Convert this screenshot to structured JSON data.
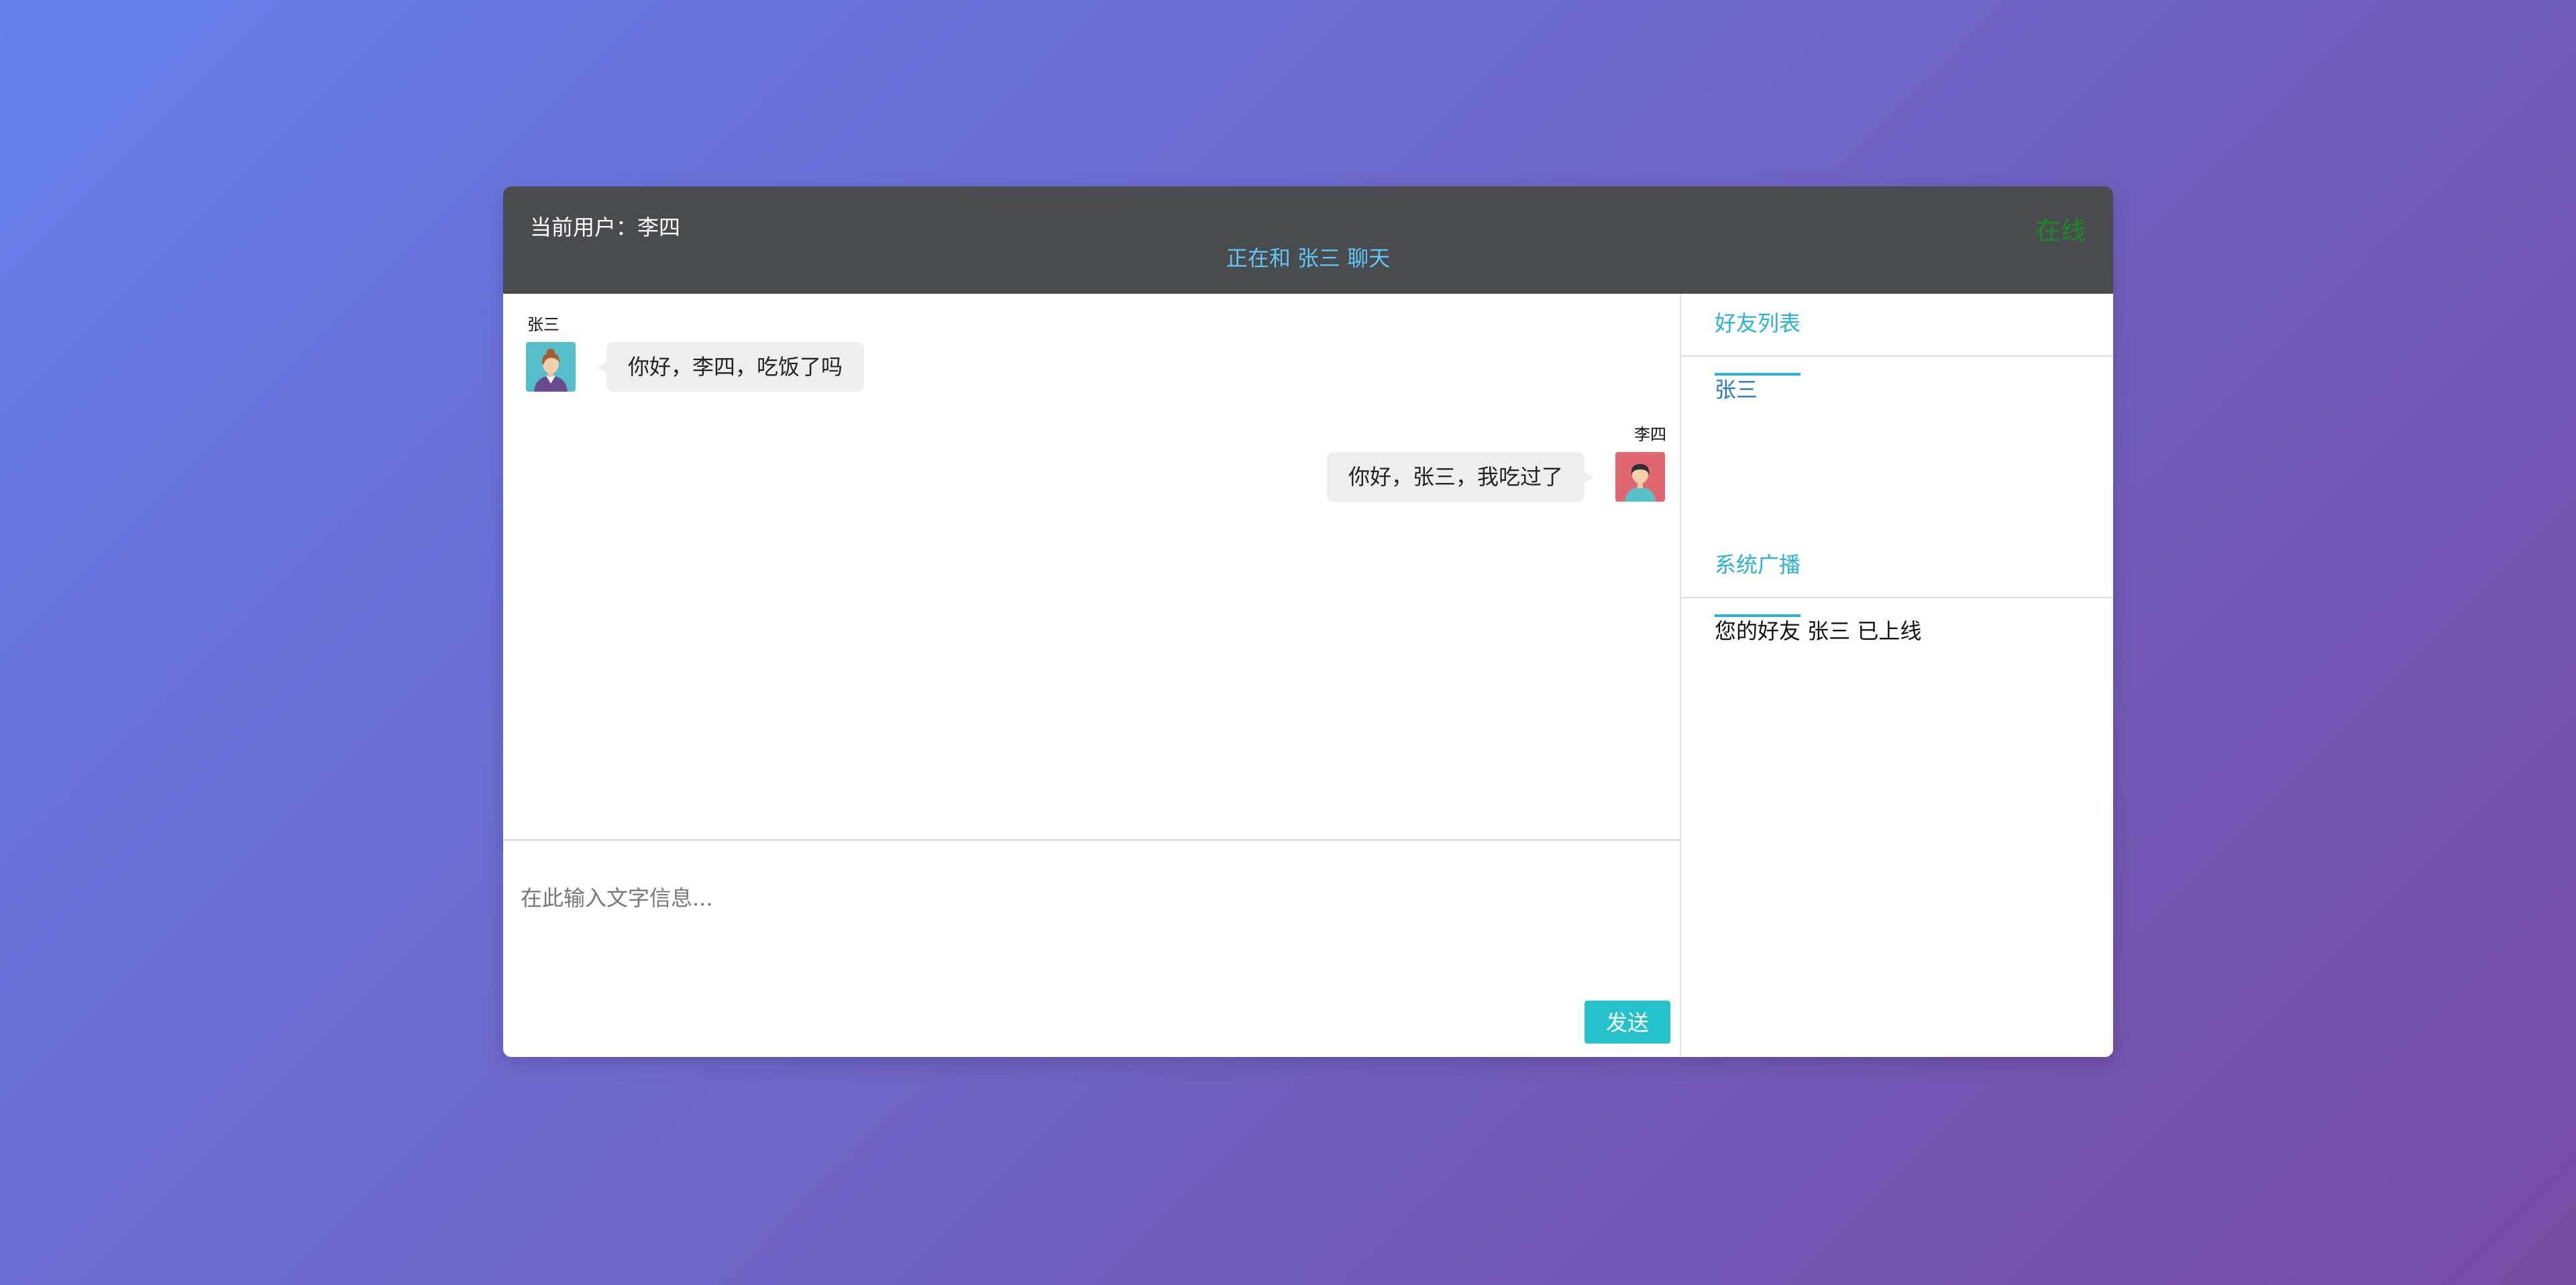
{
  "header": {
    "current_user": "当前用户：李四",
    "chatting_with": "正在和 张三 聊天",
    "status": "在线"
  },
  "messages": [
    {
      "side": "left",
      "sender": "张三",
      "text": "你好，李四，吃饭了吗",
      "avatar": "female-user-avatar"
    },
    {
      "side": "right",
      "sender": "李四",
      "text": "你好，张三，我吃过了",
      "avatar": "male-user-avatar"
    }
  ],
  "input": {
    "placeholder": "在此输入文字信息...",
    "value": "",
    "send_label": "发送"
  },
  "sidebar": {
    "friends_title": "好友列表",
    "friends": [
      "张三"
    ],
    "broadcast_title": "系统广播",
    "broadcasts": [
      "您的好友 张三 已上线"
    ]
  },
  "colors": {
    "header_bg": "#4a4b4e",
    "accent": "#2bb0d8",
    "send_button": "#26c2cc",
    "online": "#1a8a24"
  }
}
